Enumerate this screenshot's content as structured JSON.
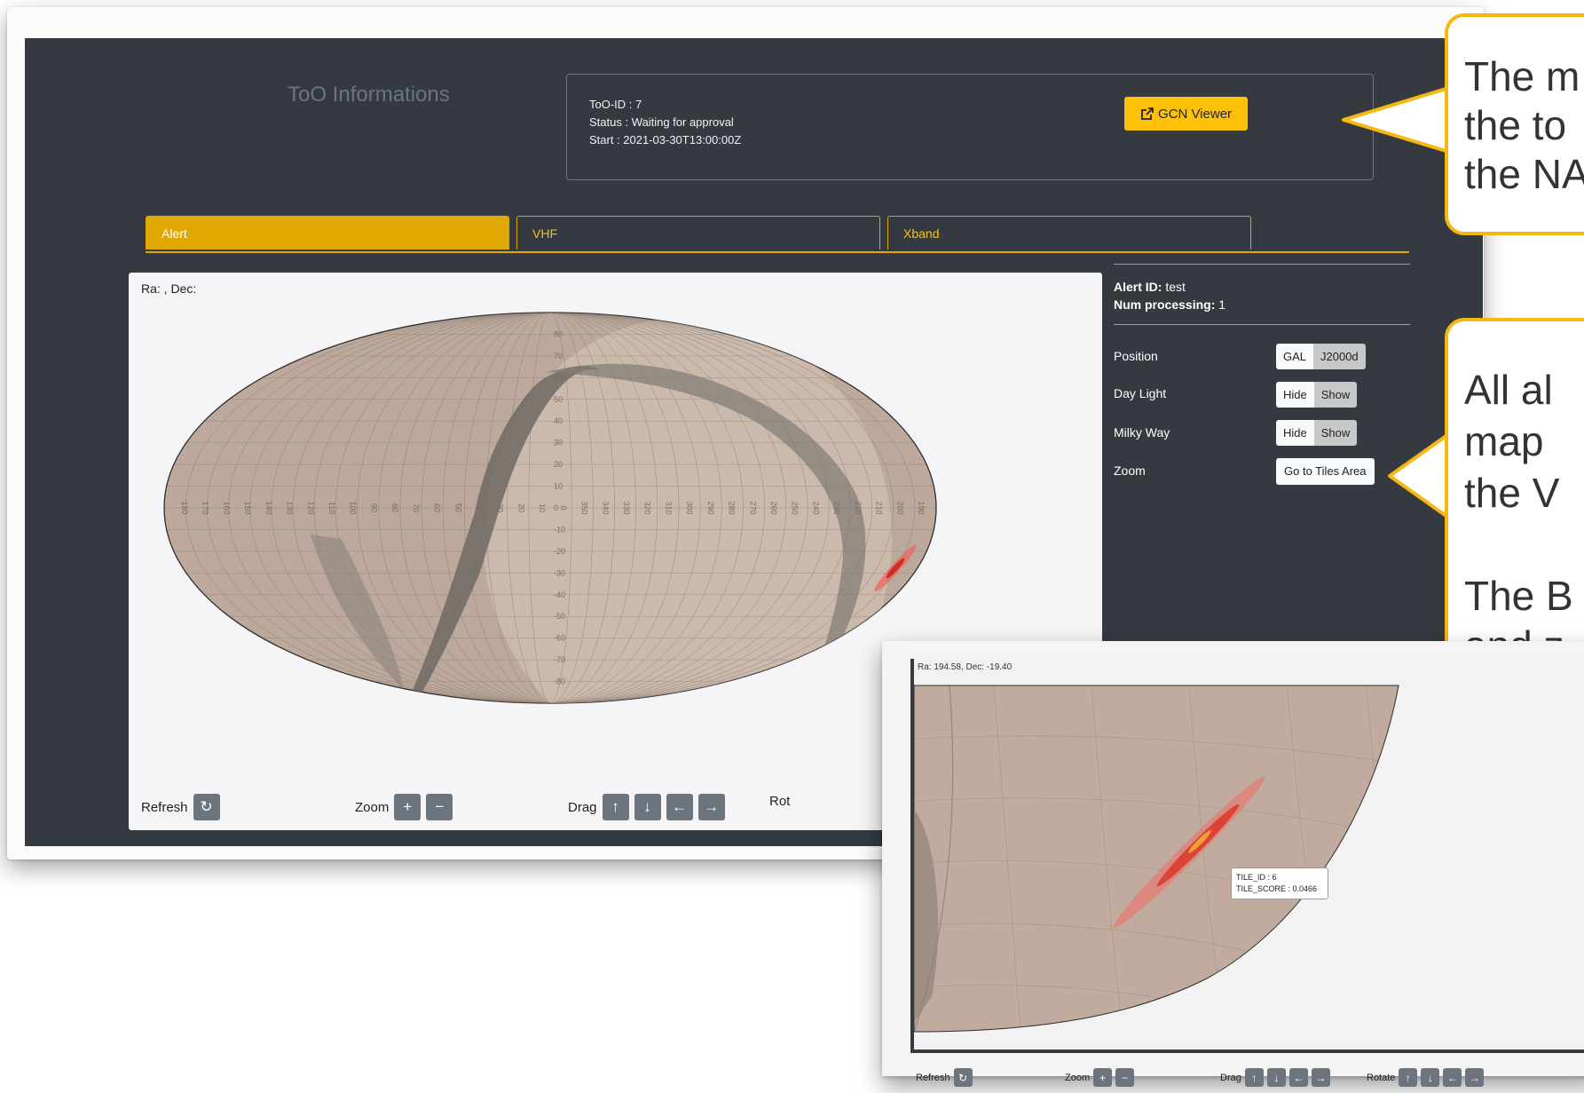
{
  "info": {
    "title": "ToO Informations",
    "too_id": "ToO-ID : 7",
    "status": "Status : Waiting for approval",
    "start": "Start : 2021-03-30T13:00:00Z",
    "gcn_button": "GCN Viewer"
  },
  "tabs": [
    "Alert",
    "VHF",
    "Xband"
  ],
  "map": {
    "coord_text": "Ra: , Dec:",
    "controls": {
      "refresh": "Refresh",
      "zoom": "Zoom",
      "drag": "Drag",
      "rotate": "Rot"
    },
    "dec_labels": [
      "80",
      "70",
      "60",
      "50",
      "40",
      "30",
      "20",
      "10",
      "0",
      "-10",
      "-20",
      "-30",
      "-40",
      "-50",
      "-60",
      "-70",
      "-80"
    ],
    "ra_labels": [
      "180",
      "170",
      "160",
      "150",
      "140",
      "130",
      "120",
      "110",
      "100",
      "90",
      "80",
      "70",
      "60",
      "50",
      "40",
      "30",
      "20",
      "10",
      "0",
      "350",
      "340",
      "330",
      "320",
      "310",
      "300",
      "290",
      "280",
      "270",
      "260",
      "250",
      "240",
      "230",
      "220",
      "210",
      "200",
      "190"
    ]
  },
  "side": {
    "alert_id_label": "Alert ID:",
    "alert_id_value": "test",
    "num_processing_label": "Num processing:",
    "num_processing_value": "1",
    "position_label": "Position",
    "position_options": [
      "GAL",
      "J2000d"
    ],
    "daylight_label": "Day Light",
    "milkyway_label": "Milky Way",
    "hide": "Hide",
    "show": "Show",
    "zoom_label": "Zoom",
    "zoom_button": "Go to Tiles Area"
  },
  "callouts": {
    "top": [
      "The m",
      "the to",
      "the NA"
    ],
    "middle": [
      "All al",
      "map",
      "the V",
      "",
      "The B",
      "and z"
    ]
  },
  "inset": {
    "coord_text": "Ra: 194.58, Dec: -19.40",
    "tooltip_tile_id": "TILE_ID : 6",
    "tooltip_tile_score": "TILE_SCORE : 0.0466",
    "controls": {
      "refresh": "Refresh",
      "zoom": "Zoom",
      "drag": "Drag",
      "rotate": "Rotate"
    }
  },
  "colors": {
    "dark_bg": "#343a40",
    "accent": "#ffc107",
    "tab_active": "#e0a800",
    "map_land": "#bba79b",
    "milky_way": "#6e6a64",
    "alert_red": "#e03c31"
  }
}
